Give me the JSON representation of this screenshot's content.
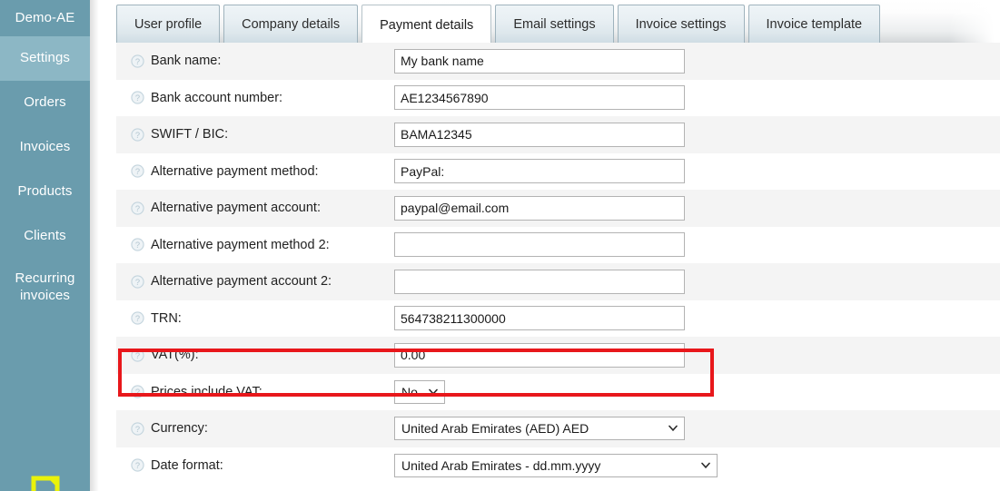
{
  "sidebar": {
    "brand": "Demo-AE",
    "items": [
      {
        "label": "Settings",
        "active": true
      },
      {
        "label": "Orders",
        "active": false
      },
      {
        "label": "Invoices",
        "active": false
      },
      {
        "label": "Products",
        "active": false
      },
      {
        "label": "Clients",
        "active": false
      },
      {
        "label": "Recurring invoices",
        "active": false
      }
    ],
    "footer_icon": "expand-icon",
    "bg_color": "#6a9cad",
    "active_color": "#8cb7c5",
    "footer_icon_color": "#eaf20a"
  },
  "tabs": [
    {
      "label": "User profile",
      "active": false
    },
    {
      "label": "Company details",
      "active": false
    },
    {
      "label": "Payment details",
      "active": true
    },
    {
      "label": "Email settings",
      "active": false
    },
    {
      "label": "Invoice settings",
      "active": false
    },
    {
      "label": "Invoice template",
      "active": false
    }
  ],
  "form": {
    "info_icon": "question-mark-circle-icon",
    "rows": [
      {
        "label": "Bank name:",
        "type": "text",
        "value": "My bank name",
        "placeholder": ""
      },
      {
        "label": "Bank account number:",
        "type": "text",
        "value": "AE1234567890",
        "placeholder": ""
      },
      {
        "label": "SWIFT / BIC:",
        "type": "text",
        "value": "BAMA12345",
        "placeholder": ""
      },
      {
        "label": "Alternative payment method:",
        "type": "text",
        "value": "PayPal:",
        "placeholder": ""
      },
      {
        "label": "Alternative payment account:",
        "type": "text",
        "value": "paypal@email.com",
        "placeholder": ""
      },
      {
        "label": "Alternative payment method 2:",
        "type": "text",
        "value": "",
        "placeholder": ""
      },
      {
        "label": "Alternative payment account 2:",
        "type": "text",
        "value": "",
        "placeholder": ""
      },
      {
        "label": "TRN:",
        "type": "text",
        "value": "564738211300000",
        "placeholder": ""
      },
      {
        "label": "VAT(%):",
        "type": "text",
        "value": "0.00",
        "placeholder": "",
        "highlighted": true
      },
      {
        "label": "Prices include VAT:",
        "type": "select",
        "value": "No",
        "size": "small"
      },
      {
        "label": "Currency:",
        "type": "select",
        "value": "United Arab Emirates (AED) AED",
        "size": "medium"
      },
      {
        "label": "Date format:",
        "type": "select",
        "value": "United Arab Emirates - dd.mm.yyyy",
        "size": "large"
      }
    ]
  },
  "highlight": {
    "target": "VAT(%):",
    "color": "#e8171b"
  }
}
